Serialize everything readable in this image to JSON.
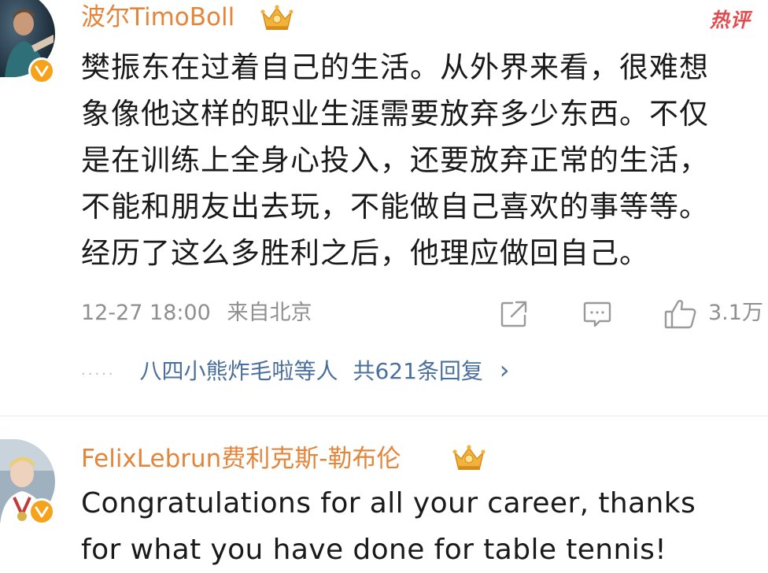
{
  "colors": {
    "username": "#e3853a",
    "hot_badge": "#e34b4f",
    "meta": "#8f8f8f",
    "reply_link": "#4a6f9c",
    "verified_badge": "#f7a21b",
    "crown": "#f2b33b"
  },
  "comments": [
    {
      "username": "波尔TimoBoll",
      "badge": "热评",
      "text_lines": [
        "樊振东在过着自己的生活。从外界来看，很难想",
        "象像他这样的职业生涯需要放弃多少东西。不仅",
        "是在训练上全身心投入，还要放弃正常的生活，",
        "不能和朋友出去玩，不能做自己喜欢的事等等。",
        "经历了这么多胜利之后，他理应做回自己。"
      ],
      "timestamp": "12-27 18:00",
      "source": "来自北京",
      "likes": "3.1万",
      "icons": [
        "share-icon",
        "comment-icon",
        "like-icon",
        "crown-icon",
        "verified-icon"
      ],
      "replies": {
        "dots": "·····",
        "users": "八四小熊炸毛啦等人",
        "count": "共621条回复",
        "chevron": "›"
      }
    },
    {
      "username": "FelixLebrun费利克斯-勒布伦",
      "text_lines": [
        "Congratulations for all your career, thanks",
        "for what you have done for table tennis!"
      ],
      "icons": [
        "crown-icon",
        "verified-icon"
      ]
    }
  ]
}
